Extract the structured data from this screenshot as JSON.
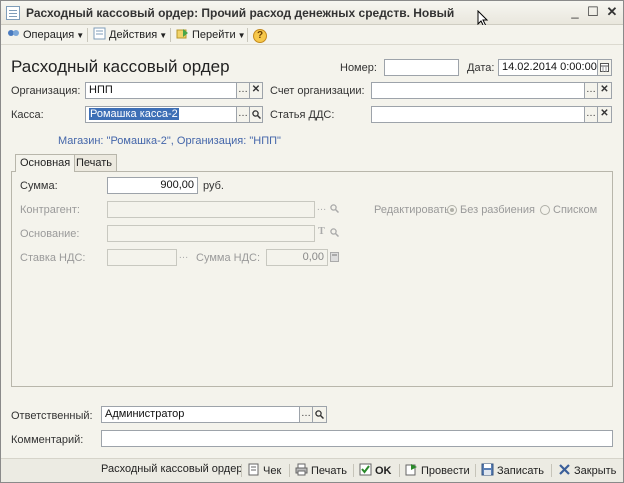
{
  "window": {
    "title": "Расходный кассовый ордер: Прочий расход денежных средств. Новый",
    "min_glyph": "_",
    "max_glyph": "☐",
    "close_glyph": "✕"
  },
  "toolbar": {
    "operation_label": "Операция",
    "actions_label": "Действия",
    "goto_label": "Перейти",
    "help_glyph": "?"
  },
  "header": {
    "doc_title": "Расходный кассовый ордер",
    "number_label": "Номер:",
    "number_value": "",
    "date_label": "Дата:",
    "date_value": "14.02.2014  0:00:00",
    "org_label": "Организация:",
    "org_value": "НПП",
    "account_label": "Счет организации:",
    "account_value": "",
    "kassa_label": "Касса:",
    "kassa_value": "Ромашка касса-2",
    "dds_label": "Статья ДДС:",
    "dds_value": "",
    "info_line": "Магазин: \"Ромашка-2\", Организация: \"НПП\""
  },
  "tabs": [
    {
      "label": "Основная"
    },
    {
      "label": "Печать"
    }
  ],
  "main": {
    "sum_label": "Сумма:",
    "sum_value": "900,00",
    "currency": "руб.",
    "counterparty_label": "Контрагент:",
    "basis_label": "Основание:",
    "vat_rate_label": "Ставка НДС:",
    "vat_sum_label": "Сумма НДС:",
    "vat_sum_value": "0,00",
    "edit_label": "Редактировать:",
    "radio_no_split": "Без разбиения",
    "radio_list": "Списком"
  },
  "footer": {
    "responsible_label": "Ответственный:",
    "responsible_value": "Администратор",
    "comment_label": "Комментарий:",
    "comment_value": ""
  },
  "bottombar": {
    "doc_name": "Расходный кассовый ордер",
    "check_label": "Чек",
    "print_label": "Печать",
    "ok_label": "OK",
    "post_label": "Провести",
    "save_label": "Записать",
    "close_label": "Закрыть"
  },
  "colors": {
    "accent": "#3d6fb6",
    "info_text": "#4466aa",
    "background": "#f4f3ec"
  }
}
